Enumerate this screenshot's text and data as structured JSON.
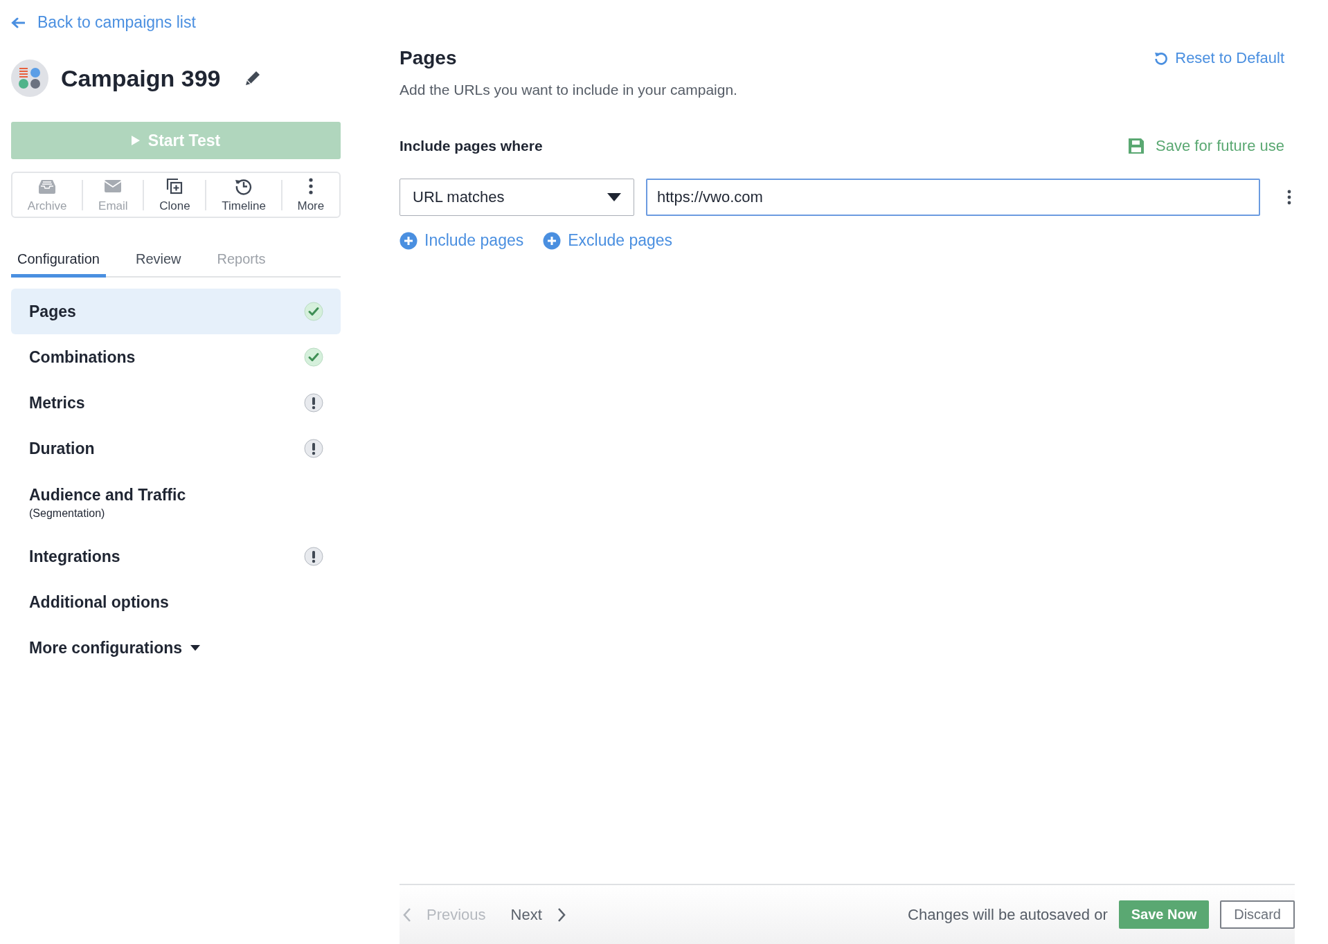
{
  "back_link": "Back to campaigns list",
  "campaign": {
    "title": "Campaign 399"
  },
  "start_button": {
    "label": "Start Test",
    "disabled": true
  },
  "actions": [
    {
      "kind": "archive",
      "label": "Archive",
      "disabled": true
    },
    {
      "kind": "email",
      "label": "Email",
      "disabled": true
    },
    {
      "kind": "clone",
      "label": "Clone",
      "disabled": false
    },
    {
      "kind": "timeline",
      "label": "Timeline",
      "disabled": false
    },
    {
      "kind": "more",
      "label": "More",
      "disabled": false
    }
  ],
  "tabs": [
    {
      "label": "Configuration",
      "selected": true,
      "disabled": false
    },
    {
      "label": "Review",
      "selected": false,
      "disabled": false
    },
    {
      "label": "Reports",
      "selected": false,
      "disabled": true
    }
  ],
  "nav": [
    {
      "kind": "complete",
      "label": "Pages",
      "selected": true
    },
    {
      "kind": "complete",
      "label": "Combinations",
      "selected": false
    },
    {
      "kind": "incomplete",
      "label": "Metrics",
      "selected": false
    },
    {
      "kind": "incomplete",
      "label": "Duration",
      "selected": false
    },
    {
      "kind": "plain",
      "label": "Audience and Traffic",
      "sublabel": "(Segmentation)",
      "selected": false
    },
    {
      "kind": "incomplete",
      "label": "Integrations",
      "selected": false
    },
    {
      "kind": "plain",
      "label": "Additional options",
      "selected": false
    },
    {
      "kind": "dropdown",
      "label": "More configurations",
      "selected": false
    }
  ],
  "main": {
    "title": "Pages",
    "subtitle": "Add the URLs you want to include in your campaign.",
    "reset_link": "Reset to Default",
    "include_label": "Include pages where",
    "save_link": "Save for future use",
    "condition": {
      "operator": "URL matches",
      "value": "https://vwo.com",
      "focused": true
    },
    "add_links": [
      "Include pages",
      "Exclude pages"
    ]
  },
  "footer": {
    "previous": {
      "label": "Previous",
      "disabled": true
    },
    "next": {
      "label": "Next",
      "disabled": false
    },
    "autosave_text": "Changes will be autosaved or",
    "save_button": "Save Now",
    "discard_button": "Discard"
  }
}
